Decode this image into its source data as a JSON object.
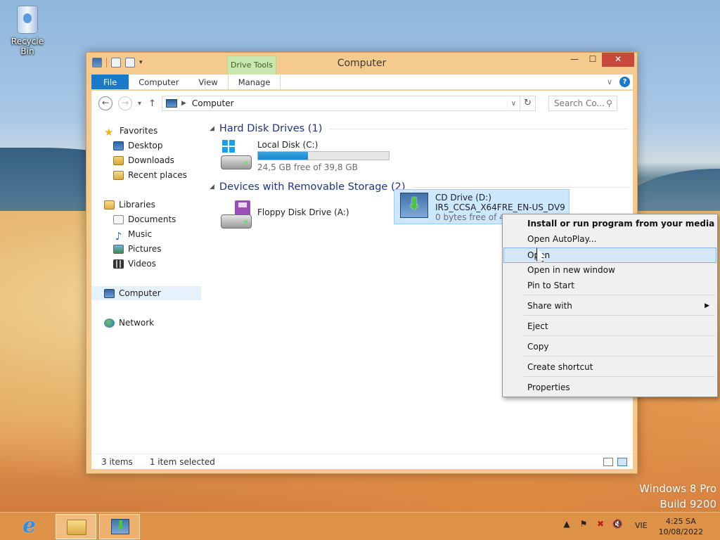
{
  "desktop": {
    "recycle_bin_label": "Recycle Bin",
    "watermark_line1": "Windows 8 Pro",
    "watermark_line2": "Build 9200"
  },
  "window": {
    "title": "Computer",
    "contextual_tab_group": "Drive Tools",
    "close_glyph": "✕",
    "minimize_glyph": "—",
    "maximize_glyph": "☐"
  },
  "ribbon": {
    "tabs": [
      {
        "label": "File"
      },
      {
        "label": "Computer"
      },
      {
        "label": "View"
      },
      {
        "label": "Manage"
      }
    ],
    "help_glyph": "?"
  },
  "address_bar": {
    "path": "Computer",
    "search_placeholder": "Search Co..."
  },
  "nav_pane": {
    "favorites": "Favorites",
    "desktop": "Desktop",
    "downloads": "Downloads",
    "recent_places": "Recent places",
    "libraries": "Libraries",
    "documents": "Documents",
    "music": "Music",
    "pictures": "Pictures",
    "videos": "Videos",
    "computer": "Computer",
    "network": "Network"
  },
  "content": {
    "groups": [
      {
        "title": "Hard Disk Drives (1)"
      },
      {
        "title": "Devices with Removable Storage (2)"
      }
    ],
    "drives": [
      {
        "name": "Local Disk (C:)",
        "detail": "24,5 GB free of 39,8 GB",
        "used_fraction": 0.384
      },
      {
        "name": "Floppy Disk Drive (A:)"
      },
      {
        "name": "CD Drive (D:)",
        "label": "IR5_CCSA_X64FRE_EN-US_DV9",
        "detail": "0 bytes free of 4,02 GB"
      }
    ]
  },
  "status_bar": {
    "items_count": "3 items",
    "selection": "1 item selected"
  },
  "context_menu": {
    "items": [
      {
        "label": "Install or run program from your media"
      },
      {
        "label": "Open AutoPlay..."
      },
      {
        "label": "Open"
      },
      {
        "label": "Open in new window"
      },
      {
        "label": "Pin to Start"
      },
      {
        "label": "Share with"
      },
      {
        "label": "Eject"
      },
      {
        "label": "Copy"
      },
      {
        "label": "Create shortcut"
      },
      {
        "label": "Properties"
      }
    ],
    "highlighted_item": "Open"
  },
  "taskbar": {
    "language": "VIE",
    "time": "4:25 SA",
    "date": "10/08/2022"
  },
  "colors": {
    "accent": "#1979ca",
    "window_frame": "#f5ca8e",
    "selection": "#cce8ff",
    "close_button": "#c7493b"
  }
}
